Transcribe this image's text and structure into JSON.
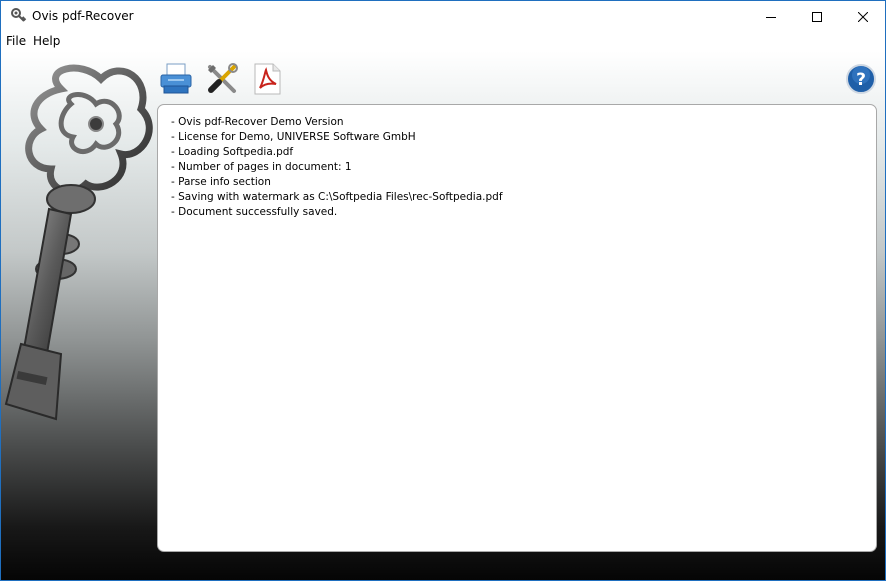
{
  "window": {
    "title": "Ovis pdf-Recover",
    "app_icon": "key-app-icon",
    "controls": {
      "minimize_icon": "minimize-icon",
      "maximize_icon": "maximize-icon",
      "close_icon": "close-icon"
    }
  },
  "menubar": {
    "items": [
      {
        "label": "File"
      },
      {
        "label": "Help"
      }
    ]
  },
  "toolbar": {
    "buttons": [
      {
        "icon": "printer-icon"
      },
      {
        "icon": "tools-icon"
      },
      {
        "icon": "pdf-document-icon"
      }
    ],
    "help_icon": "help-icon"
  },
  "log": {
    "lines": [
      "- Ovis pdf-Recover Demo Version",
      "- License for Demo, UNIVERSE Software GmbH",
      "- Loading Softpedia.pdf",
      "- Number of pages in document: 1",
      "- Parse info section",
      "- Saving with watermark as C:\\Softpedia Files\\rec-Softpedia.pdf",
      "- Document successfully saved."
    ]
  },
  "colors": {
    "window_border": "#1f6fbf",
    "help_button": "#1f5fa8",
    "pdf_red": "#c8231c",
    "log_panel_border": "#a8a8a8"
  }
}
